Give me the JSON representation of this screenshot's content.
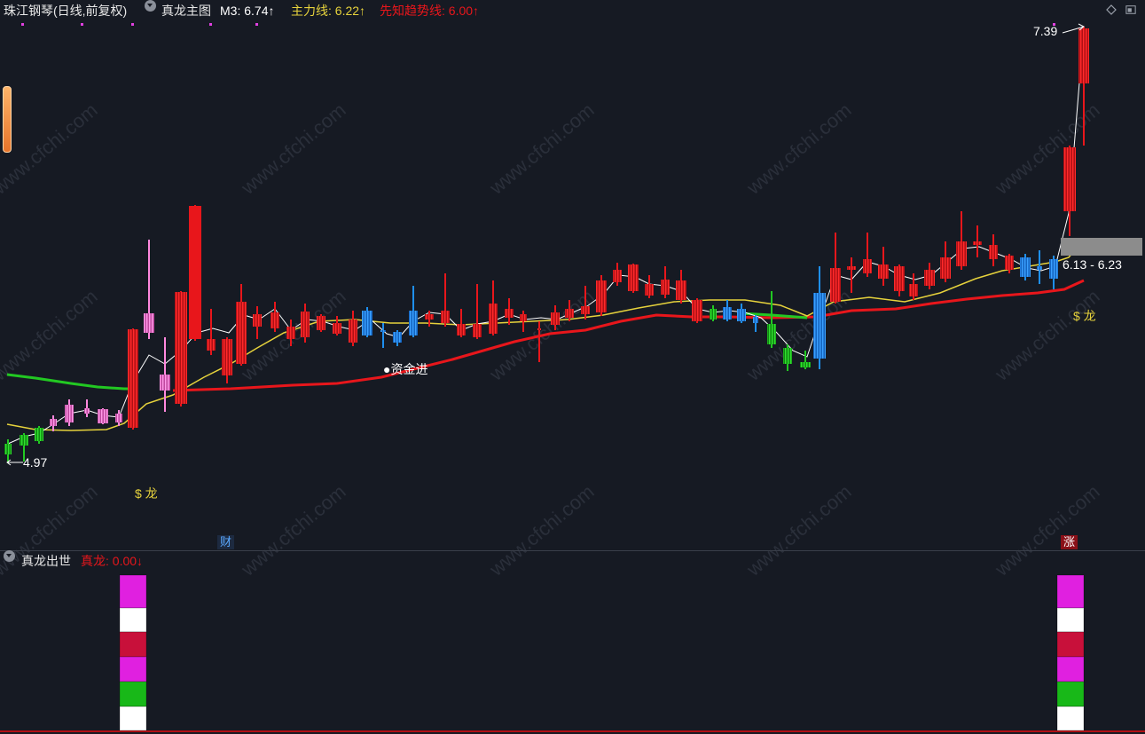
{
  "header": {
    "stock": "珠江钢琴(日线,前复权)",
    "indicator": "真龙主图",
    "m3": "M3: 6.74↑",
    "main_line": "主力线: 6.22↑",
    "trend_line": "先知趋势线: 6.00↑"
  },
  "sub_header": {
    "indicator": "真龙出世",
    "value": "真龙: 0.00↓"
  },
  "labels": {
    "high_price": "7.39",
    "low_price": "4.97",
    "range": "6.13 - 6.23",
    "dragon_1": "$ 龙",
    "dragon_2": "$ 龙",
    "funds_in": "●资金进",
    "cai_badge": "财",
    "zhang_badge": "涨",
    "watermark": "www.cfchi.com"
  },
  "colors": {
    "background": "#161a23",
    "up": "#e8161b",
    "down_green": "#20c020",
    "blue": "#1e8ff0",
    "pink": "#ff88dd",
    "main_line": "#e6d23c",
    "trend_line": "#e8161b",
    "m3_line": "#ffffff"
  }
}
